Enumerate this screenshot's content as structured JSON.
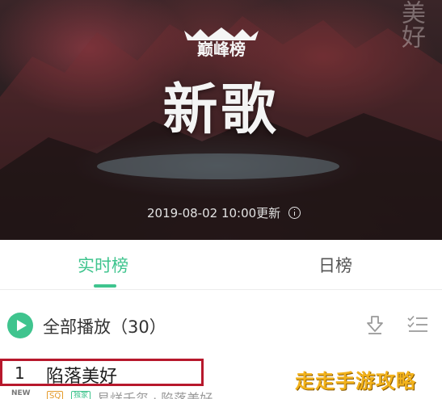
{
  "hero": {
    "logo_text": "巅峰榜",
    "title": "新歌",
    "deco_text": "美好",
    "update_text": "2019-08-02  10:00更新",
    "info_icon": "info-icon"
  },
  "tabs": [
    {
      "label": "实时榜",
      "active": true
    },
    {
      "label": "日榜",
      "active": false
    }
  ],
  "playbar": {
    "play_icon": "play-icon",
    "label": "全部播放（30）",
    "download_icon": "download-icon",
    "multiselect_icon": "multi-select-icon"
  },
  "songs": [
    {
      "rank": "1",
      "title": "陷落美好",
      "new_tag": "NEW",
      "quality_tag": "SQ",
      "exclusive_tag": "独家",
      "subtitle": "易烊千玺 · 陷落美好"
    }
  ],
  "watermark": "走走手游攻略",
  "colors": {
    "accent": "#3fc48e",
    "highlight_border": "#b7182c",
    "watermark": "#f2b21b",
    "sq_tag": "#e49a2a"
  }
}
